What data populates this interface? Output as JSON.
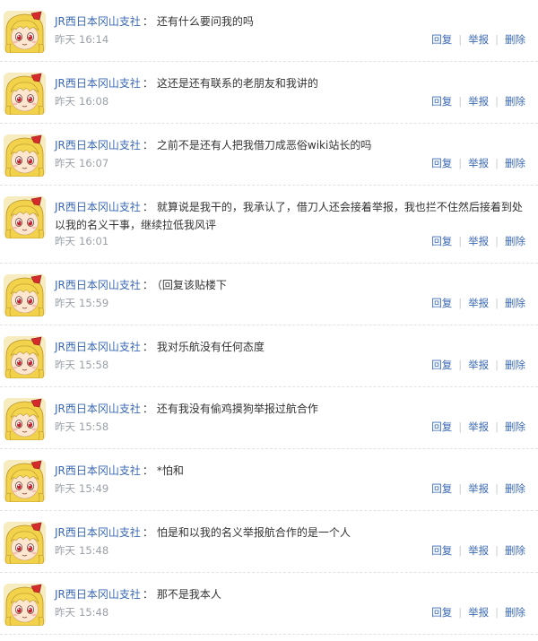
{
  "labels": {
    "reply": "回复",
    "report": "举报",
    "delete": "删除",
    "separator": "："
  },
  "comments": [
    {
      "user": "JR西日本冈山支社",
      "text": "还有什么要问我的吗",
      "day": "昨天",
      "time": "16:14"
    },
    {
      "user": "JR西日本冈山支社",
      "text": "这还是还有联系的老朋友和我讲的",
      "day": "昨天",
      "time": "16:08"
    },
    {
      "user": "JR西日本冈山支社",
      "text": "之前不是还有人把我借刀成恶俗wiki站长的吗",
      "day": "昨天",
      "time": "16:07"
    },
    {
      "user": "JR西日本冈山支社",
      "text": "就算说是我干的，我承认了，借刀人还会接着举报，我也拦不住然后接着到处以我的名义干事，继续拉低我风评",
      "day": "昨天",
      "time": "16:01"
    },
    {
      "user": "JR西日本冈山支社",
      "text": "（回复该贴楼下",
      "day": "昨天",
      "time": "15:59"
    },
    {
      "user": "JR西日本冈山支社",
      "text": "我对乐航没有任何态度",
      "day": "昨天",
      "time": "15:58"
    },
    {
      "user": "JR西日本冈山支社",
      "text": "还有我没有偷鸡摸狗举报过航合作",
      "day": "昨天",
      "time": "15:58"
    },
    {
      "user": "JR西日本冈山支社",
      "text": "*怕和",
      "day": "昨天",
      "time": "15:49"
    },
    {
      "user": "JR西日本冈山支社",
      "text": "怕是和以我的名义举报航合作的是一个人",
      "day": "昨天",
      "time": "15:48"
    },
    {
      "user": "JR西日本冈山支社",
      "text": "那不是我本人",
      "day": "昨天",
      "time": "15:48"
    }
  ]
}
